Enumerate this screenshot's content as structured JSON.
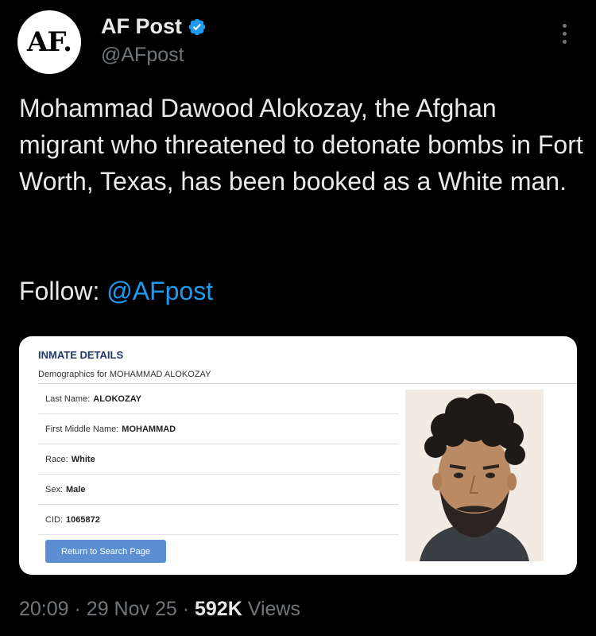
{
  "tweet": {
    "avatar_text": "AF.",
    "author_name": "AF Post",
    "author_handle": "@AFpost",
    "verified": true,
    "more_icon": "more-horizontal-icon",
    "text": "Mohammad Dawood Alokozay, the Afghan migrant who threatened to detonate bombs in Fort Worth, Texas, has been booked as a White man.",
    "follow_label": "Follow:",
    "follow_handle": "@AFpost",
    "time": "20:09",
    "date": "29 Nov 25",
    "separator": "·",
    "views_count": "592K",
    "views_label": "Views"
  },
  "inmate_card": {
    "title": "INMATE DETAILS",
    "subtitle": "Demographics for MOHAMMAD ALOKOZAY",
    "fields": [
      {
        "label": "Last Name:",
        "value": "ALOKOZAY"
      },
      {
        "label": "First Middle Name:",
        "value": "MOHAMMAD"
      },
      {
        "label": "Race:",
        "value": "White"
      },
      {
        "label": "Sex:",
        "value": "Male"
      },
      {
        "label": "CID:",
        "value": "1065872"
      }
    ],
    "button_label": "Return to Search Page"
  },
  "colors": {
    "background": "#000000",
    "text": "#e7e9ea",
    "muted": "#71767b",
    "link": "#1d9bf0",
    "verified_badge": "#1d9bf0",
    "button": "#5b8fd1"
  }
}
